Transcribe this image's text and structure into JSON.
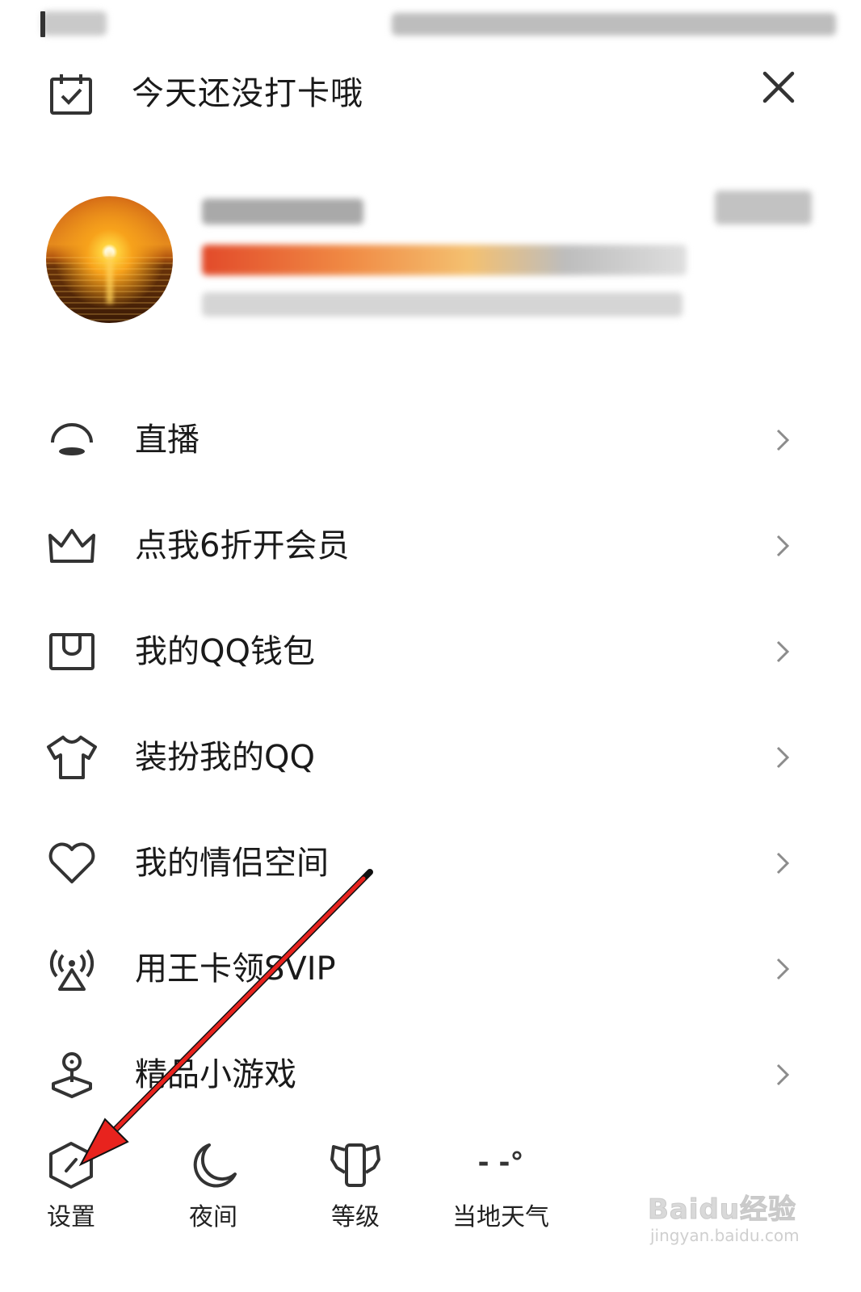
{
  "checkin": {
    "text": "今天还没打卡哦"
  },
  "menu": {
    "items": [
      {
        "label": "直播"
      },
      {
        "label": "点我6折开会员"
      },
      {
        "label": "我的QQ钱包"
      },
      {
        "label": "装扮我的QQ"
      },
      {
        "label": "我的情侣空间"
      },
      {
        "label": "用王卡领SVIP"
      },
      {
        "label": "精品小游戏"
      }
    ]
  },
  "toolbar": {
    "settings": "设置",
    "night": "夜间",
    "level": "等级",
    "weather": "当地天气"
  },
  "weather_value": "- -°",
  "watermark": {
    "main": "Baidu经验",
    "sub": "jingyan.baidu.com"
  },
  "colors": {
    "annotation_arrow": "#e8231e",
    "icon_stroke": "#333333",
    "chevron": "#8c8c8c"
  }
}
